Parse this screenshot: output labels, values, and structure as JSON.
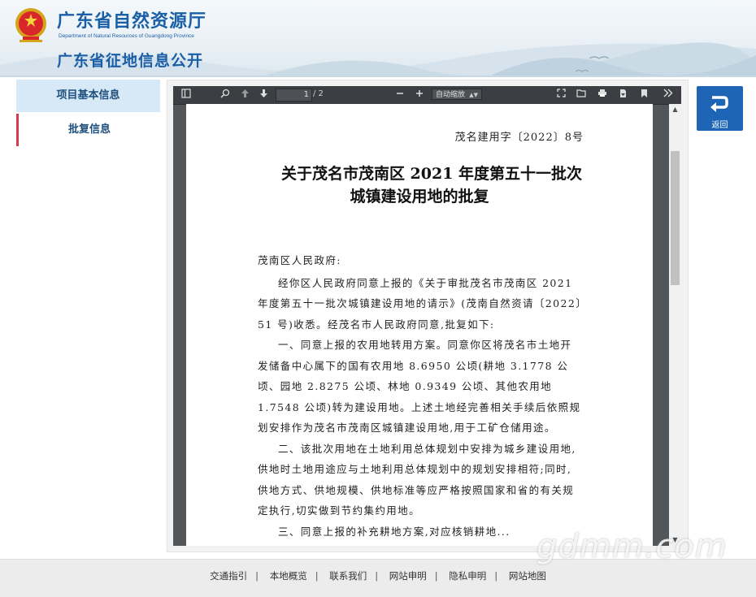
{
  "header": {
    "title": "广东省自然资源厅",
    "subtitle": "Department of Natural Resources of Guangdong Province",
    "section_title": "广东省征地信息公开"
  },
  "sidebar": {
    "items": [
      {
        "label": "项目基本信息"
      },
      {
        "label": "批复信息"
      }
    ]
  },
  "viewer": {
    "page_input": "1",
    "page_total": "/ 2",
    "zoom_select": "自动缩放"
  },
  "document": {
    "doc_number": "茂名建用字〔2022〕8号",
    "title_line1": "关于茂名市茂南区 2021 年度第五十一批次",
    "title_line2": "城镇建设用地的批复",
    "salutation": "茂南区人民政府:",
    "paragraph1": "经你区人民政府同意上报的《关于审批茂名市茂南区 2021 年度第五十一批次城镇建设用地的请示》(茂南自然资请〔2022〕51 号)收悉。经茂名市人民政府同意,批复如下:",
    "paragraph2": "一、同意上报的农用地转用方案。同意你区将茂名市土地开发储备中心属下的国有农用地 8.6950 公顷(耕地 3.1778 公顷、园地 2.8275 公顷、林地 0.9349 公顷、其他农用地 1.7548 公顷)转为建设用地。上述土地经完善相关手续后依照规划安排作为茂名市茂南区城镇建设用地,用于工矿仓储用途。",
    "paragraph3": "二、该批次用地在土地利用总体规划中安排为城乡建设用地,供地时土地用途应与土地利用总体规划中的规划安排相符;同时,供地方式、供地规模、供地标准等应严格按照国家和省的有关规定执行,切实做到节约集约用地。",
    "paragraph4": "三、同意上报的补充耕地方案,对应核销耕地..."
  },
  "back_button": {
    "label": "返回"
  },
  "footer": {
    "links": [
      "交通指引",
      "本地概览",
      "联系我们",
      "网站申明",
      "隐私申明",
      "网站地图"
    ]
  },
  "watermark": "gdmm.com",
  "colors": {
    "brand_blue": "#1a5fa6",
    "sidebar_active_bg": "#d7e8f6",
    "sidebar_marker": "#d83a4a",
    "back_button_bg": "#1e66b5",
    "viewer_bg": "#525659",
    "toolbar_bg": "#3b3e42"
  },
  "icons": {
    "emblem": "national-emblem",
    "sidebar_toggle": "sidebar-toggle-icon",
    "find": "search-icon",
    "prev": "arrow-up-icon",
    "next": "arrow-down-icon",
    "zoom_out": "minus-icon",
    "zoom_in": "plus-icon",
    "presentation": "fullscreen-icon",
    "open": "open-file-icon",
    "print": "print-icon",
    "download": "download-icon",
    "bookmark": "bookmark-icon",
    "tools": "double-chevron-right-icon",
    "back": "return-arrow-icon"
  }
}
